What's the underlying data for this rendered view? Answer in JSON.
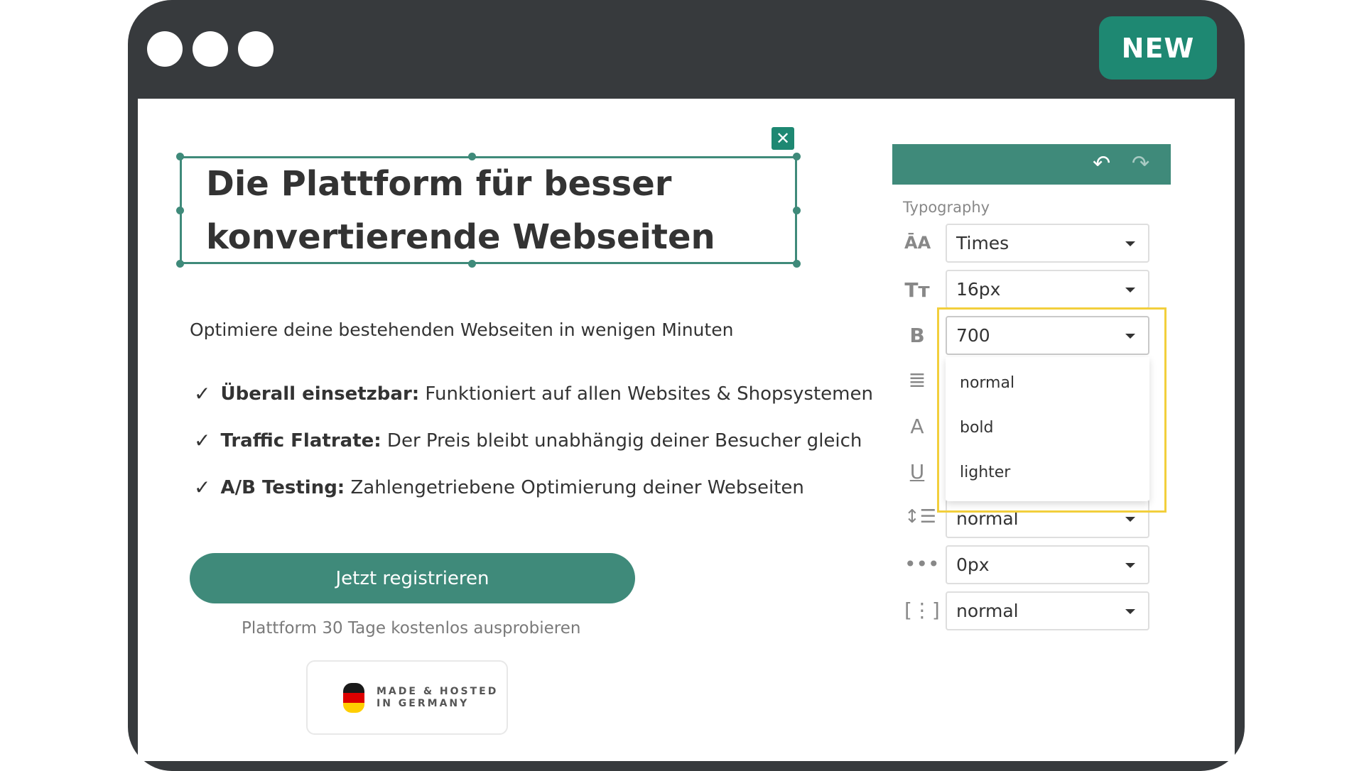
{
  "window": {
    "badge": "NEW"
  },
  "editor": {
    "headline_line1": "Die Plattform für besser",
    "headline_line2": "konvertierende Webseiten",
    "close_icon": "close-icon",
    "subheadline": "Optimiere deine bestehenden Webseiten in wenigen Minuten",
    "features": [
      {
        "title": "Überall einsetzbar:",
        "text": " Funktioniert auf allen Websites & Shopsystemen"
      },
      {
        "title": "Traffic Flatrate:",
        "text": " Der Preis bleibt unabhängig deiner Besucher gleich"
      },
      {
        "title": "A/B Testing:",
        "text": " Zahlengetriebene Optimierung deiner Webseiten"
      }
    ],
    "cta_label": "Jetzt registrieren",
    "trial_text": "Plattform 30 Tage kostenlos ausprobieren",
    "badge_line1": "MADE & HOSTED",
    "badge_line2": "IN GERMANY"
  },
  "panel": {
    "section_label": "Typography",
    "font_family": "Times",
    "font_size": "16px",
    "font_weight": "700",
    "weight_options": [
      "normal",
      "bold",
      "lighter"
    ],
    "line_height": "normal",
    "letter_spacing": "0px",
    "word_spacing": "normal",
    "icons": {
      "font": "font-family-icon",
      "size": "font-size-icon",
      "bold": "bold-icon",
      "align": "text-align-icon",
      "color": "text-color-icon",
      "underline": "underline-icon",
      "line_height": "line-height-icon",
      "letter_spacing": "letter-spacing-icon",
      "word_spacing": "word-spacing-icon"
    }
  },
  "colors": {
    "frame": "#373a3d",
    "brand": "#3f8a7a",
    "badge": "#1e8872",
    "highlight": "#f2cf3c"
  }
}
